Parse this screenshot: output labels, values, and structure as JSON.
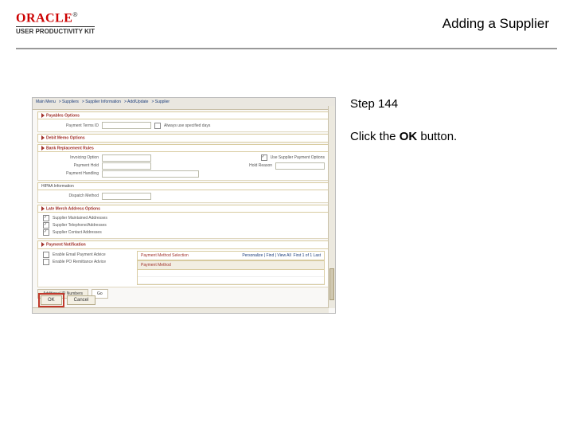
{
  "header": {
    "brand": "ORACLE",
    "tm": "®",
    "subbrand": "USER PRODUCTIVITY KIT",
    "title": "Adding a Supplier"
  },
  "instructions": {
    "step": "Step 144",
    "text_before": "Click the ",
    "bold": "OK",
    "text_after": " button."
  },
  "screenshot": {
    "menubar": [
      "Main Menu",
      "Suppliers",
      "Supplier Information",
      "Add/Update",
      "Supplier"
    ],
    "sections": {
      "payables": "Payables Options",
      "payables_sub": "Always use specified days",
      "debit_memo": "Debit Memo Options",
      "bank_repl": "Bank Replacement Rules",
      "hipaa": "HIPAA Information",
      "late_addr": "Late Merch Address Options",
      "payment_notif": "Payment Notification"
    },
    "fields": {
      "payment_terms": "Payment Terms ID",
      "invoicing": "Invoicing Option",
      "payment_hold": "Payment Hold",
      "payment_handling": "Payment Handling",
      "hold_reason": "Hold Reason",
      "use_sup_opts": "Use Supplier Payment Options",
      "dispatch": "Dispatch Method",
      "sup_maint_addr": "Supplier Maintained Addresses",
      "sup_tel": "Supplier Telephone/Addresses",
      "sup_contact": "Supplier Contact Addresses",
      "enable_email": "Enable Email Payment Advice",
      "enable_po": "Enable PO Remittance Advice"
    },
    "grid": {
      "title": "Payment Method Selection",
      "subtitle": "Payment Method",
      "nav": "Personalize | Find |  View All",
      "count": "First   1 of 1   Last"
    },
    "tabs": {
      "additional": "Additional ID Numbers",
      "go": "Go"
    },
    "buttons": {
      "ok": "OK",
      "cancel": "Cancel"
    }
  }
}
